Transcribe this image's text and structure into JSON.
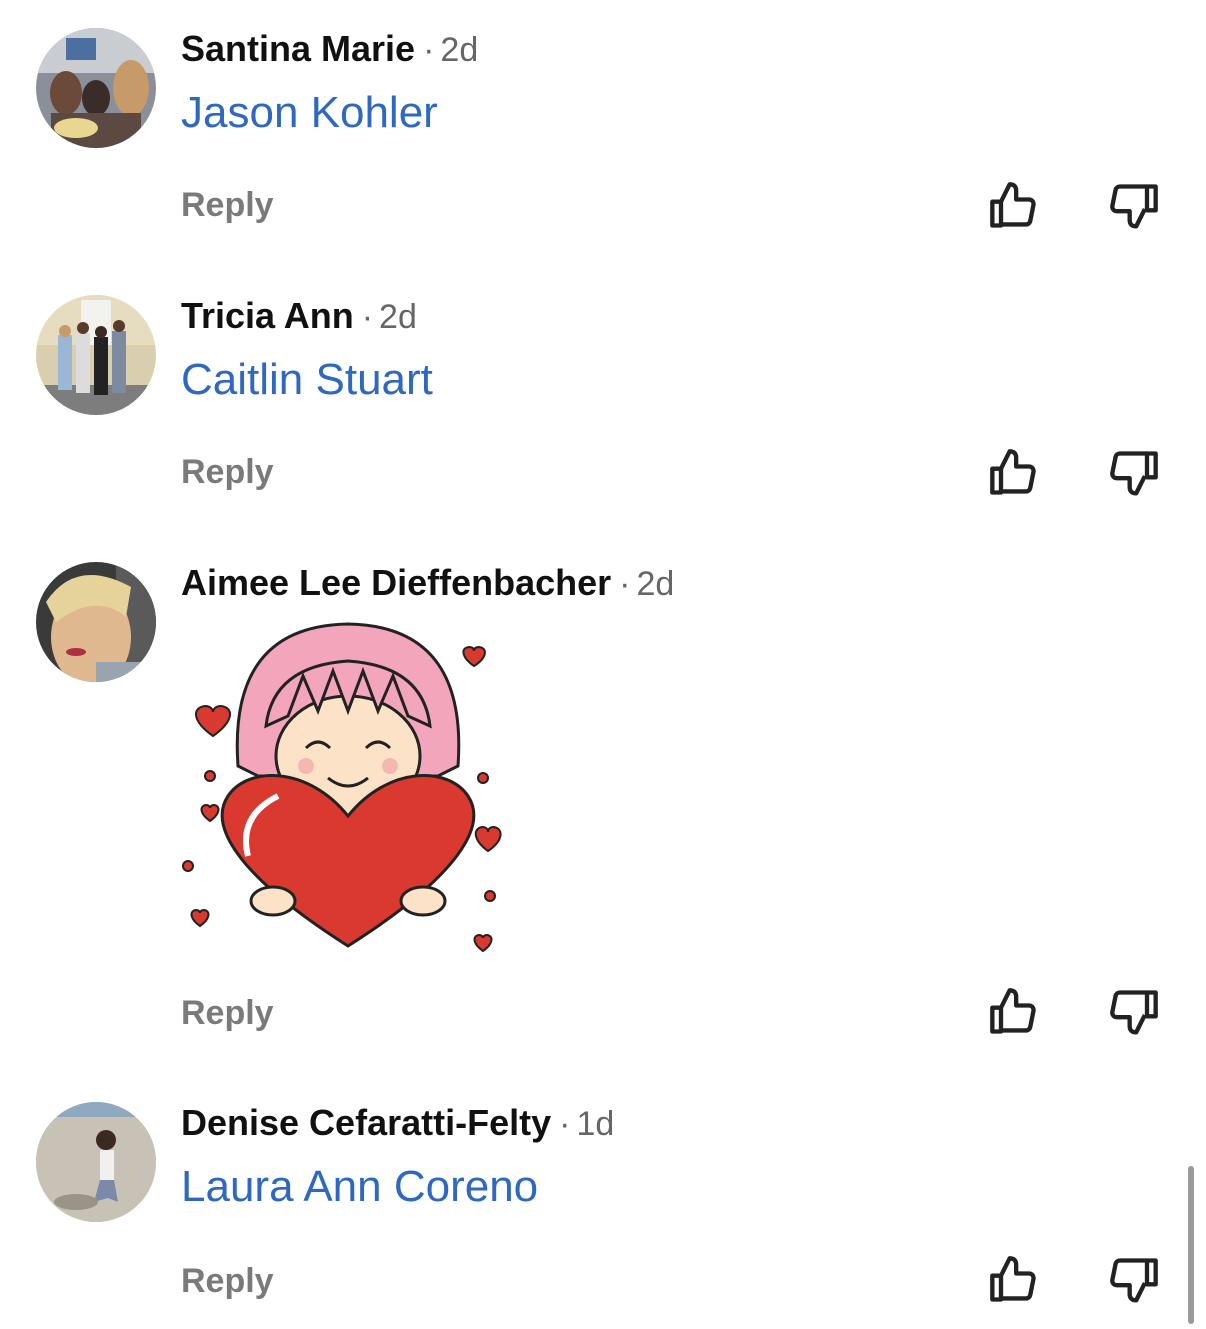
{
  "comments": [
    {
      "author": "Santina Marie",
      "separator": "·",
      "time": "2d",
      "mention": "Jason Kohler",
      "reply": "Reply"
    },
    {
      "author": "Tricia Ann",
      "separator": "·",
      "time": "2d",
      "mention": "Caitlin Stuart",
      "reply": "Reply"
    },
    {
      "author": "Aimee Lee Dieffenbacher",
      "separator": "·",
      "time": "2d",
      "sticker": "girl-hugging-heart-sticker",
      "reply": "Reply"
    },
    {
      "author": "Denise Cefaratti-Felty",
      "separator": "·",
      "time": "1d",
      "mention": "Laura Ann Coreno",
      "reply": "Reply"
    }
  ],
  "icons": {
    "like": "thumbs-up-icon",
    "dislike": "thumbs-down-icon"
  },
  "colors": {
    "mention": "#2e68c0",
    "reply": "#7a7a7a",
    "heart": "#d9392f",
    "hair": "#f3a6bb"
  }
}
